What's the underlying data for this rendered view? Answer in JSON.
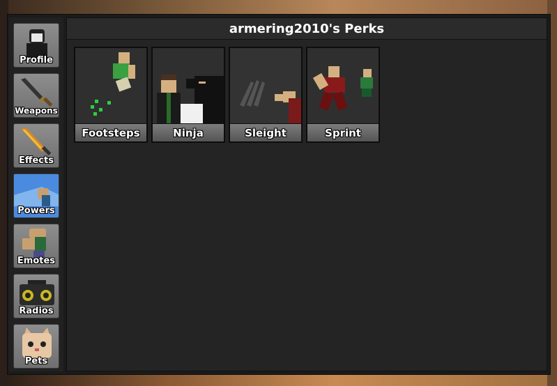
{
  "title": "armering2010's Perks",
  "sidebar": {
    "items": [
      {
        "label": "Profile",
        "active": false
      },
      {
        "label": "Weapons",
        "active": false
      },
      {
        "label": "Effects",
        "active": false
      },
      {
        "label": "Powers",
        "active": true
      },
      {
        "label": "Emotes",
        "active": false
      },
      {
        "label": "Radios",
        "active": false
      },
      {
        "label": "Pets",
        "active": false
      }
    ]
  },
  "perks": [
    {
      "label": "Footsteps"
    },
    {
      "label": "Ninja"
    },
    {
      "label": "Sleight"
    },
    {
      "label": "Sprint"
    }
  ],
  "colors": {
    "active_tab": "#4a8be0",
    "panel_bg": "#242424",
    "tab_bg": "#7a7a7a"
  }
}
